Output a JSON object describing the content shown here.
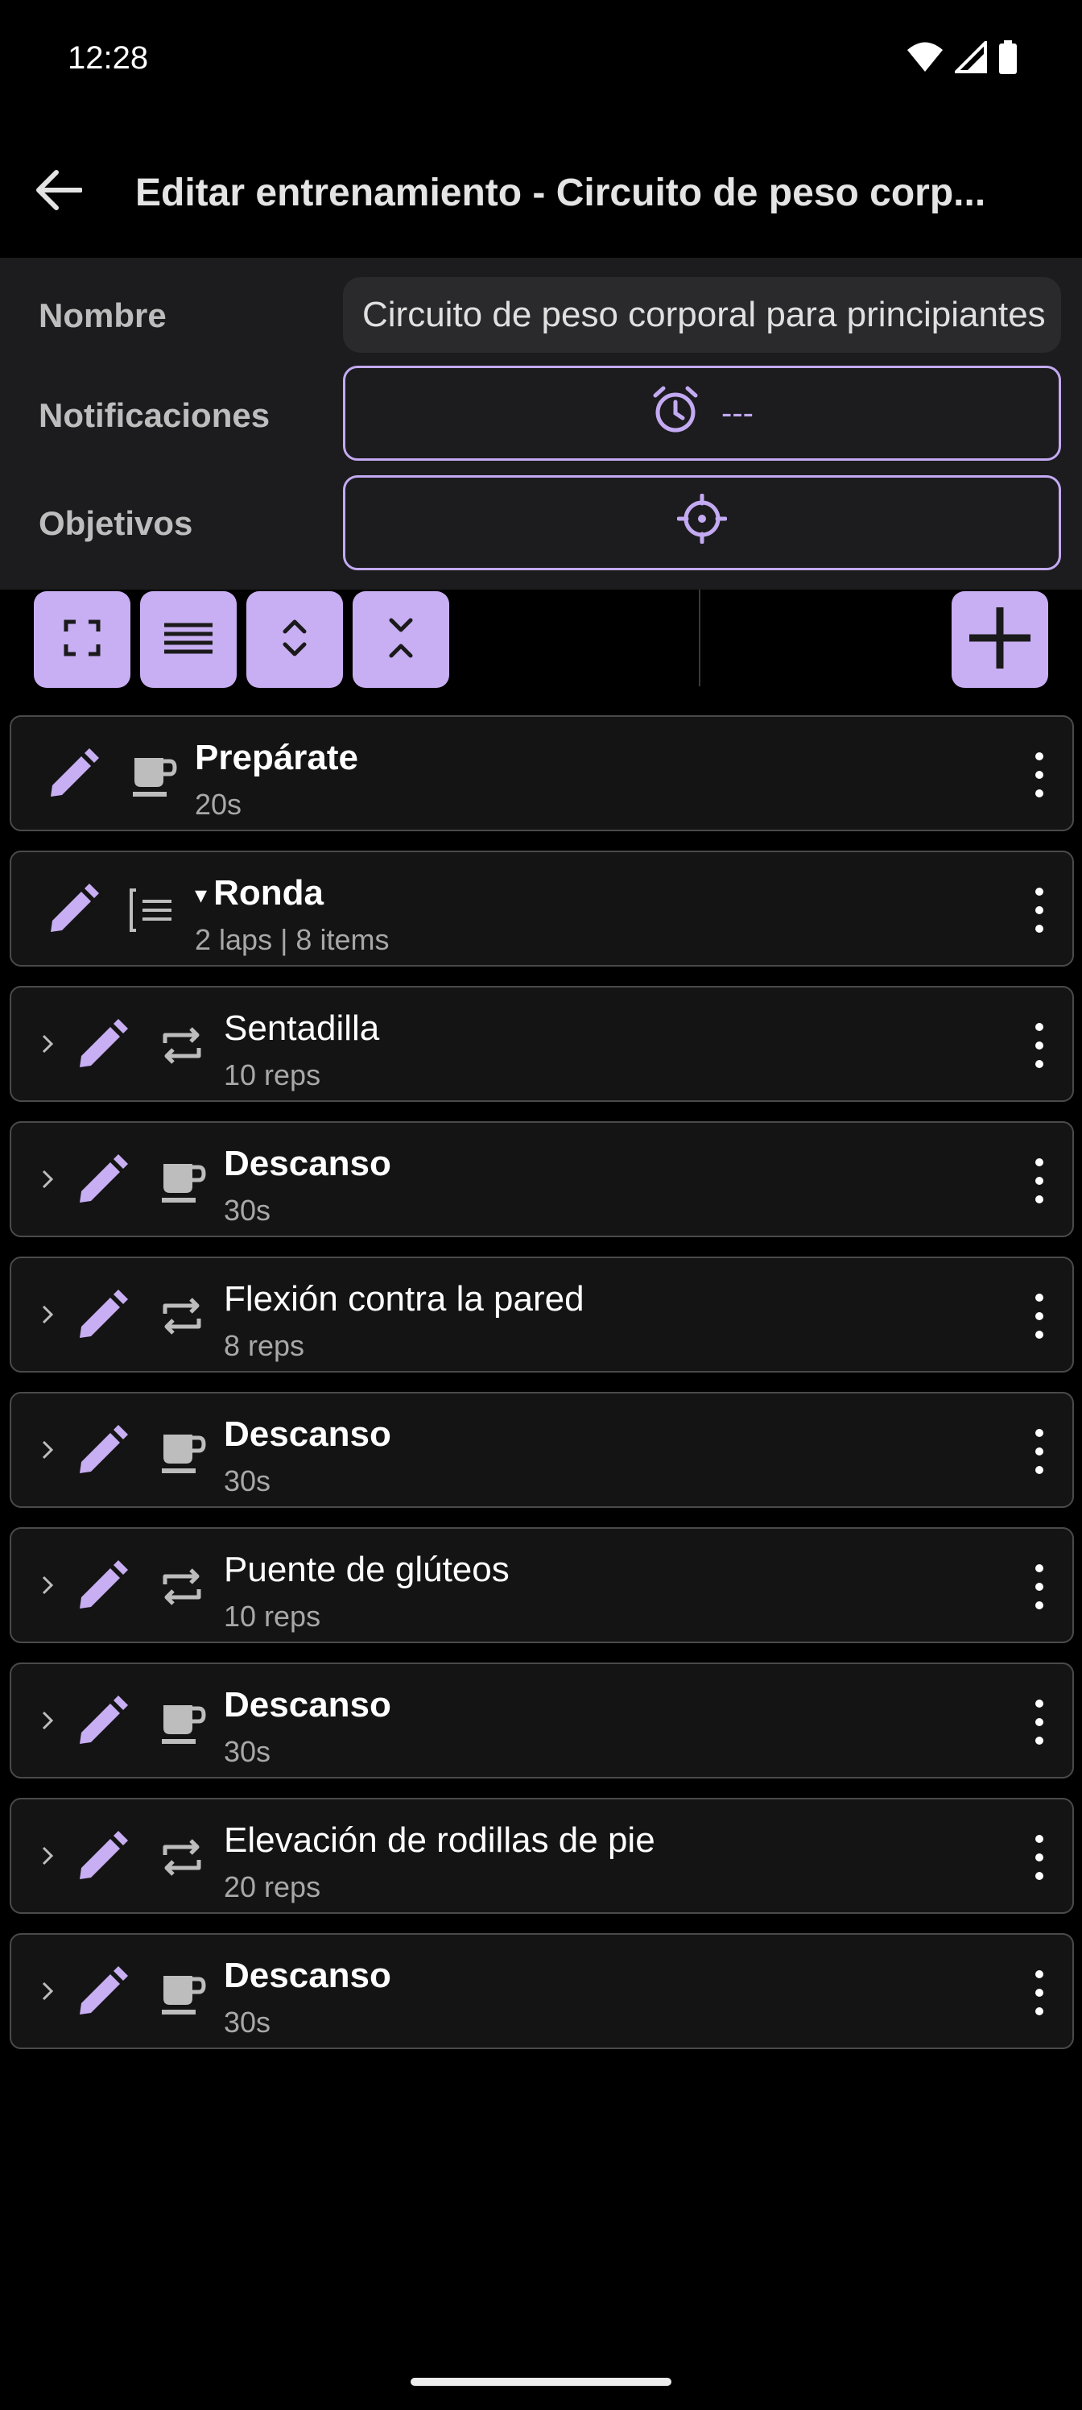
{
  "status_bar": {
    "time": "12:28"
  },
  "app_bar": {
    "title": "Editar entrenamiento - Circuito de peso corp..."
  },
  "form": {
    "name_label": "Nombre",
    "name_value": "Circuito de peso corporal para principiantes",
    "notifications_label": "Notificaciones",
    "notifications_value": "---",
    "goals_label": "Objetivos"
  },
  "colors": {
    "accent": "#c8aef2",
    "accent_text": "#c3aaf2",
    "panel": "#1c1c1e"
  },
  "items": [
    {
      "title": "Prepárate",
      "subtitle": "20s",
      "icon": "coffee-icon",
      "bold": true,
      "nested": false
    },
    {
      "title": "Ronda",
      "subtitle": "2 laps | 8 items",
      "icon": "round-icon",
      "bold": true,
      "nested": false,
      "expanded_marker": "▾"
    },
    {
      "title": "Sentadilla",
      "subtitle": "10 reps",
      "icon": "repeat-icon",
      "bold": false,
      "nested": true
    },
    {
      "title": "Descanso",
      "subtitle": "30s",
      "icon": "coffee-icon",
      "bold": true,
      "nested": true
    },
    {
      "title": "Flexión contra la pared",
      "subtitle": "8 reps",
      "icon": "repeat-icon",
      "bold": false,
      "nested": true
    },
    {
      "title": "Descanso",
      "subtitle": "30s",
      "icon": "coffee-icon",
      "bold": true,
      "nested": true
    },
    {
      "title": "Puente de glúteos",
      "subtitle": "10 reps",
      "icon": "repeat-icon",
      "bold": false,
      "nested": true
    },
    {
      "title": "Descanso",
      "subtitle": "30s",
      "icon": "coffee-icon",
      "bold": true,
      "nested": true
    },
    {
      "title": "Elevación de rodillas de pie",
      "subtitle": "20 reps",
      "icon": "repeat-icon",
      "bold": false,
      "nested": true
    },
    {
      "title": "Descanso",
      "subtitle": "30s",
      "icon": "coffee-icon",
      "bold": true,
      "nested": true
    }
  ]
}
